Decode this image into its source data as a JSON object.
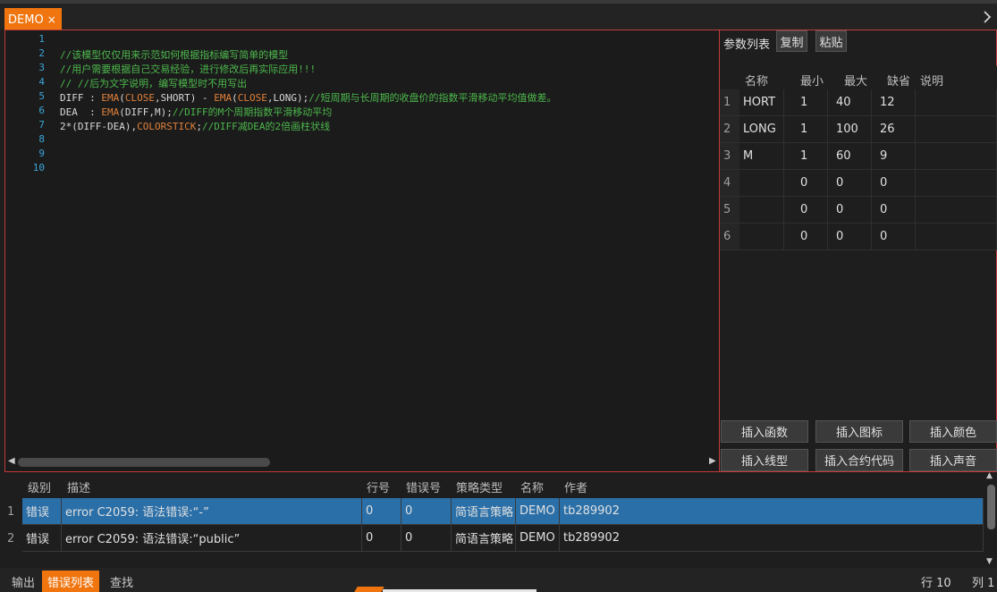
{
  "tab": {
    "label": "DEMO",
    "close": "×"
  },
  "editor": {
    "line_numbers": [
      "1",
      "2",
      "3",
      "4",
      "5",
      "6",
      "7",
      "8",
      "9",
      "10"
    ],
    "lines": [
      {
        "parts": [
          {
            "t": "",
            "c": ""
          }
        ]
      },
      {
        "parts": [
          {
            "t": "//该模型仅仅用来示范如何根据指标编写简单的模型",
            "c": "cm"
          }
        ]
      },
      {
        "parts": [
          {
            "t": "//用户需要根据自己交易经验，进行修改后再实际应用!!!",
            "c": "cm"
          }
        ]
      },
      {
        "parts": [
          {
            "t": "// //后为文字说明，编写模型时不用写出",
            "c": "cm"
          }
        ]
      },
      {
        "parts": [
          {
            "t": "DIFF : ",
            "c": ""
          },
          {
            "t": "EMA",
            "c": "fn"
          },
          {
            "t": "(",
            "c": ""
          },
          {
            "t": "CLOSE",
            "c": "fn"
          },
          {
            "t": ",SHORT) - ",
            "c": ""
          },
          {
            "t": "EMA",
            "c": "fn"
          },
          {
            "t": "(",
            "c": ""
          },
          {
            "t": "CLOSE",
            "c": "fn"
          },
          {
            "t": ",LONG);",
            "c": ""
          },
          {
            "t": "//短周期与长周期的收盘价的指数平滑移动平均值做差。",
            "c": "cm"
          }
        ]
      },
      {
        "parts": [
          {
            "t": "DEA  : ",
            "c": ""
          },
          {
            "t": "EMA",
            "c": "fn"
          },
          {
            "t": "(DIFF,M);",
            "c": ""
          },
          {
            "t": "//DIFF的M个周期指数平滑移动平均",
            "c": "cm"
          }
        ]
      },
      {
        "parts": [
          {
            "t": "2*(DIFF-DEA),",
            "c": ""
          },
          {
            "t": "COLORSTICK",
            "c": "fn"
          },
          {
            "t": ";",
            "c": ""
          },
          {
            "t": "//DIFF减DEA的2倍画柱状线",
            "c": "cm"
          }
        ]
      },
      {
        "parts": [
          {
            "t": "",
            "c": ""
          }
        ]
      },
      {
        "parts": [
          {
            "t": "",
            "c": ""
          }
        ]
      },
      {
        "parts": [
          {
            "t": "",
            "c": ""
          }
        ]
      }
    ],
    "scroll_left": "◀",
    "scroll_right": "▶"
  },
  "params": {
    "title": "参数列表",
    "copy_label": "复制",
    "paste_label": "粘贴",
    "headers": [
      "名称",
      "最小",
      "最大",
      "缺省",
      "说明"
    ],
    "rows": [
      {
        "n": "1",
        "name": "HORT",
        "min": "1",
        "max": "40",
        "def": "12",
        "desc": ""
      },
      {
        "n": "2",
        "name": "LONG",
        "min": "1",
        "max": "100",
        "def": "26",
        "desc": ""
      },
      {
        "n": "3",
        "name": "M",
        "min": "1",
        "max": "60",
        "def": "9",
        "desc": ""
      },
      {
        "n": "4",
        "name": "",
        "min": "0",
        "max": "0",
        "def": "0",
        "desc": ""
      },
      {
        "n": "5",
        "name": "",
        "min": "0",
        "max": "0",
        "def": "0",
        "desc": ""
      },
      {
        "n": "6",
        "name": "",
        "min": "0",
        "max": "0",
        "def": "0",
        "desc": ""
      }
    ],
    "insert_buttons": [
      "插入函数",
      "插入图标",
      "插入颜色",
      "插入线型",
      "插入合约代码",
      "插入声音"
    ]
  },
  "errors": {
    "headers": [
      "级别",
      "描述",
      "行号",
      "错误号",
      "策略类型",
      "名称",
      "作者"
    ],
    "rows": [
      {
        "n": "1",
        "level": "错误",
        "desc": "error C2059: 语法错误:“-”",
        "line": "0",
        "code": "0",
        "type": "简语言策略",
        "name": "DEMO",
        "author": "tb289902",
        "selected": true
      },
      {
        "n": "2",
        "level": "错误",
        "desc": "error C2059: 语法错误:“public”",
        "line": "0",
        "code": "0",
        "type": "简语言策略",
        "name": "DEMO",
        "author": "tb289902",
        "selected": false
      }
    ]
  },
  "status": {
    "tabs": [
      "输出",
      "错误列表",
      "查找"
    ],
    "row": "行 10",
    "col": "列 1"
  },
  "colors": {
    "accent": "#f0750f",
    "selection": "#2a6fa8",
    "comment": "#4cb84c",
    "keyword": "#e0803a",
    "linenum": "#3aa6d8"
  }
}
